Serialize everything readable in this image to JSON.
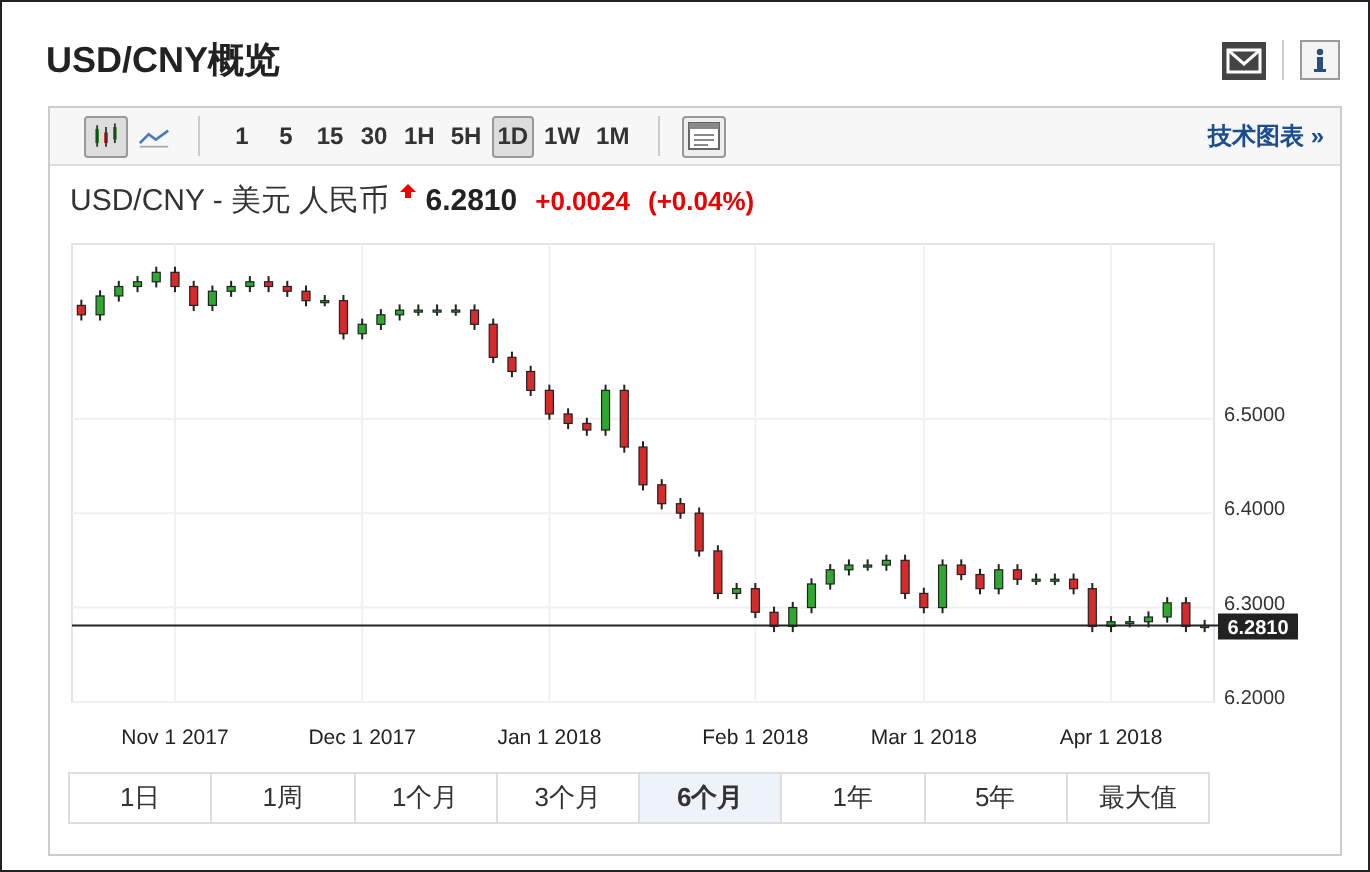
{
  "header": {
    "title": "USD/CNY概览"
  },
  "toolbar": {
    "chart_types": [
      {
        "kind": "candlestick",
        "selected": true
      },
      {
        "kind": "line",
        "selected": false
      }
    ],
    "intervals": [
      {
        "label": "1",
        "selected": false
      },
      {
        "label": "5",
        "selected": false
      },
      {
        "label": "15",
        "selected": false
      },
      {
        "label": "30",
        "selected": false
      },
      {
        "label": "1H",
        "selected": false
      },
      {
        "label": "5H",
        "selected": false
      },
      {
        "label": "1D",
        "selected": true
      },
      {
        "label": "1W",
        "selected": false
      },
      {
        "label": "1M",
        "selected": false
      }
    ],
    "link": "技术图表 »"
  },
  "quote": {
    "name": "USD/CNY - 美元 人民币",
    "rising": true,
    "price": "6.2810",
    "change": "+0.0024",
    "change_pct": "(+0.04%)"
  },
  "chart": {
    "chart_data": {
      "type": "candlestick",
      "categories": [
        null,
        null,
        null,
        null,
        null,
        "Nov 1 2017",
        null,
        null,
        null,
        null,
        null,
        null,
        null,
        null,
        null,
        "Dec 1 2017",
        null,
        null,
        null,
        null,
        null,
        null,
        null,
        null,
        null,
        "Jan 1 2018",
        null,
        null,
        null,
        null,
        null,
        null,
        null,
        null,
        null,
        null,
        "Feb 1 2018",
        null,
        null,
        null,
        null,
        null,
        null,
        null,
        null,
        "Mar 1 2018",
        null,
        null,
        null,
        null,
        null,
        null,
        null,
        null,
        null,
        "Apr 1 2018",
        null,
        null,
        null,
        null,
        null
      ],
      "ohlc": [
        [
          6.62,
          6.626,
          6.604,
          6.61
        ],
        [
          6.61,
          6.636,
          6.604,
          6.63
        ],
        [
          6.63,
          6.646,
          6.624,
          6.64
        ],
        [
          6.64,
          6.651,
          6.634,
          6.645
        ],
        [
          6.645,
          6.661,
          6.639,
          6.655
        ],
        [
          6.655,
          6.661,
          6.634,
          6.64
        ],
        [
          6.64,
          6.646,
          6.614,
          6.62
        ],
        [
          6.62,
          6.641,
          6.614,
          6.635
        ],
        [
          6.635,
          6.646,
          6.629,
          6.64
        ],
        [
          6.64,
          6.651,
          6.634,
          6.645
        ],
        [
          6.645,
          6.651,
          6.634,
          6.64
        ],
        [
          6.64,
          6.646,
          6.629,
          6.635
        ],
        [
          6.635,
          6.641,
          6.619,
          6.625
        ],
        [
          6.625,
          6.631,
          6.619,
          6.625
        ],
        [
          6.625,
          6.631,
          6.584,
          6.59
        ],
        [
          6.59,
          6.606,
          6.584,
          6.6
        ],
        [
          6.6,
          6.616,
          6.594,
          6.61
        ],
        [
          6.61,
          6.621,
          6.604,
          6.615
        ],
        [
          6.615,
          6.621,
          6.609,
          6.615
        ],
        [
          6.615,
          6.621,
          6.609,
          6.615
        ],
        [
          6.615,
          6.621,
          6.609,
          6.615
        ],
        [
          6.615,
          6.621,
          6.594,
          6.6
        ],
        [
          6.6,
          6.606,
          6.559,
          6.565
        ],
        [
          6.565,
          6.571,
          6.544,
          6.55
        ],
        [
          6.55,
          6.556,
          6.524,
          6.53
        ],
        [
          6.53,
          6.536,
          6.499,
          6.505
        ],
        [
          6.505,
          6.511,
          6.489,
          6.495
        ],
        [
          6.495,
          6.501,
          6.482,
          6.488
        ],
        [
          6.488,
          6.536,
          6.482,
          6.53
        ],
        [
          6.53,
          6.536,
          6.464,
          6.47
        ],
        [
          6.47,
          6.476,
          6.424,
          6.43
        ],
        [
          6.43,
          6.436,
          6.404,
          6.41
        ],
        [
          6.41,
          6.416,
          6.394,
          6.4
        ],
        [
          6.4,
          6.406,
          6.354,
          6.36
        ],
        [
          6.36,
          6.366,
          6.309,
          6.315
        ],
        [
          6.315,
          6.326,
          6.309,
          6.32
        ],
        [
          6.32,
          6.326,
          6.289,
          6.295
        ],
        [
          6.295,
          6.301,
          6.274,
          6.28
        ],
        [
          6.28,
          6.306,
          6.274,
          6.3
        ],
        [
          6.3,
          6.331,
          6.294,
          6.325
        ],
        [
          6.325,
          6.346,
          6.319,
          6.34
        ],
        [
          6.34,
          6.351,
          6.334,
          6.345
        ],
        [
          6.345,
          6.351,
          6.339,
          6.345
        ],
        [
          6.345,
          6.356,
          6.339,
          6.35
        ],
        [
          6.35,
          6.356,
          6.309,
          6.315
        ],
        [
          6.315,
          6.321,
          6.294,
          6.3
        ],
        [
          6.3,
          6.351,
          6.294,
          6.345
        ],
        [
          6.345,
          6.351,
          6.329,
          6.335
        ],
        [
          6.335,
          6.341,
          6.314,
          6.32
        ],
        [
          6.32,
          6.346,
          6.314,
          6.34
        ],
        [
          6.34,
          6.346,
          6.324,
          6.33
        ],
        [
          6.33,
          6.336,
          6.324,
          6.33
        ],
        [
          6.33,
          6.336,
          6.324,
          6.33
        ],
        [
          6.33,
          6.336,
          6.314,
          6.32
        ],
        [
          6.32,
          6.326,
          6.274,
          6.28
        ],
        [
          6.28,
          6.291,
          6.274,
          6.285
        ],
        [
          6.285,
          6.291,
          6.279,
          6.285
        ],
        [
          6.285,
          6.296,
          6.279,
          6.29
        ],
        [
          6.29,
          6.311,
          6.284,
          6.305
        ],
        [
          6.305,
          6.311,
          6.274,
          6.28
        ],
        [
          6.28,
          6.287,
          6.274,
          6.281
        ]
      ],
      "ylim": [
        6.2,
        6.685
      ],
      "grid": true,
      "ref_lines": [
        {
          "axis": "y",
          "value": 6.281,
          "label": "6.2810",
          "color": "#222222"
        }
      ],
      "yticks": [
        {
          "value": 6.2,
          "label": "6.2000"
        },
        {
          "value": 6.3,
          "label": "6.3000"
        },
        {
          "value": 6.4,
          "label": "6.4000"
        },
        {
          "value": 6.5,
          "label": "6.5000"
        }
      ]
    }
  },
  "ranges": [
    {
      "label": "1日",
      "selected": false
    },
    {
      "label": "1周",
      "selected": false
    },
    {
      "label": "1个月",
      "selected": false
    },
    {
      "label": "3个月",
      "selected": false
    },
    {
      "label": "6个月",
      "selected": true
    },
    {
      "label": "1年",
      "selected": false
    },
    {
      "label": "5年",
      "selected": false
    },
    {
      "label": "最大值",
      "selected": false
    }
  ]
}
